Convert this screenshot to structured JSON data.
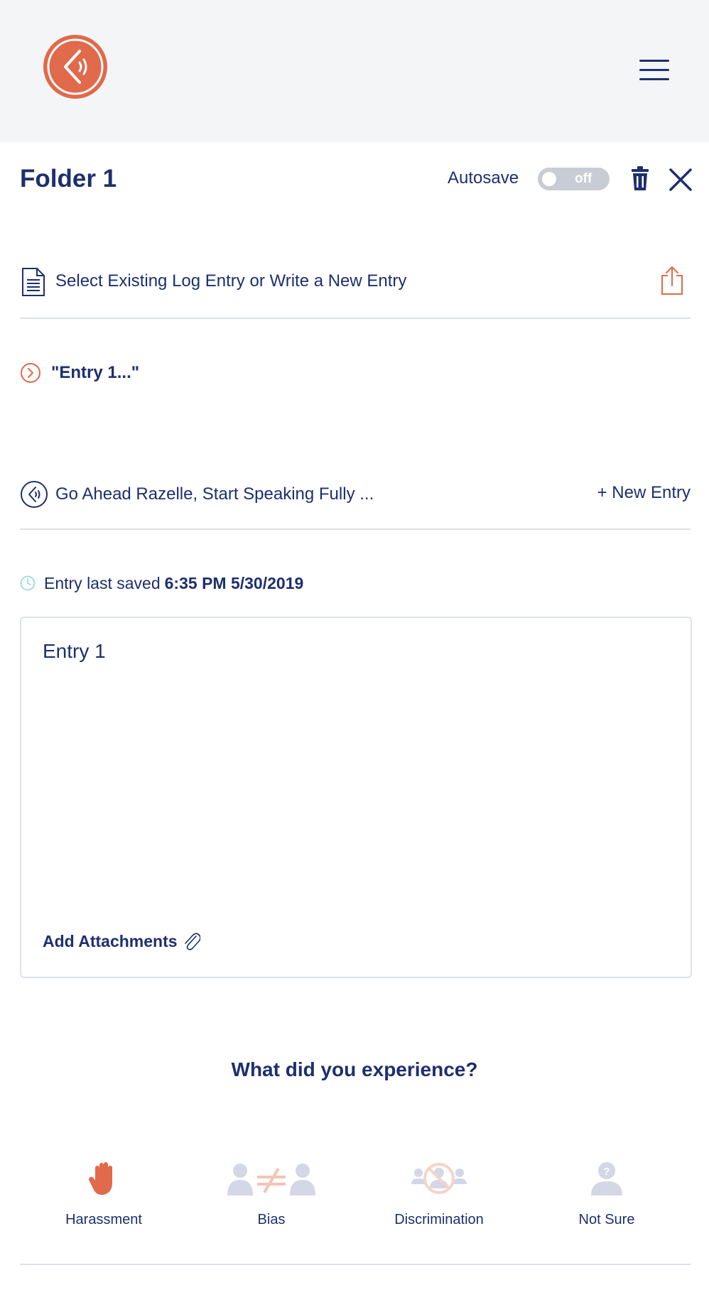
{
  "header": {
    "logo_icon": "speaker-chevron-logo-icon",
    "menu_icon": "hamburger-menu-icon"
  },
  "folder": {
    "title": "Folder 1",
    "autosave_label": "Autosave",
    "autosave_state": "off",
    "delete_icon": "trash-icon",
    "close_icon": "close-icon"
  },
  "log": {
    "select_label": "Select Existing Log Entry or Write a New Entry",
    "share_icon": "share-icon",
    "selected_entry": "\"Entry 1...\"",
    "prompt": "Go Ahead Razelle, Start Speaking Fully ...",
    "new_entry_label": "+ New Entry"
  },
  "entry": {
    "saved_label": "Entry last saved",
    "saved_value": "6:35 PM 5/30/2019",
    "text": "Entry 1",
    "attach_label": "Add Attachments"
  },
  "experience": {
    "question": "What did you experience?",
    "options": [
      {
        "label": "Harassment",
        "icon": "raised-hand-icon",
        "selected": true
      },
      {
        "label": "Bias",
        "icon": "not-equal-people-icon",
        "selected": false
      },
      {
        "label": "Discrimination",
        "icon": "discrimination-icon",
        "selected": false
      },
      {
        "label": "Not Sure",
        "icon": "question-person-icon",
        "selected": false
      }
    ]
  },
  "colors": {
    "primary": "#1d2f6f",
    "accent": "#e06a4b",
    "muted_icon": "#d3d7e6",
    "divider": "#dde1e8",
    "header_bg": "#f4f5f7"
  }
}
